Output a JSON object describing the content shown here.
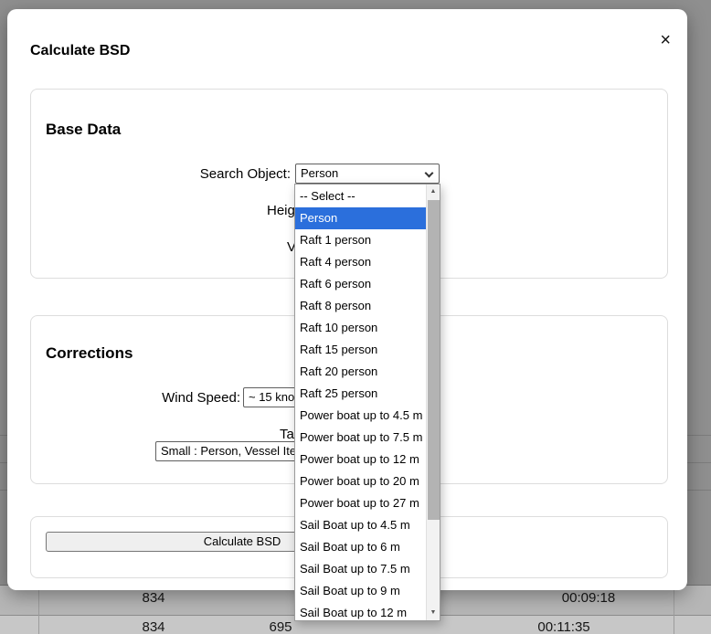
{
  "modal": {
    "title": "Calculate BSD",
    "close_icon": "×",
    "base_data": {
      "section_title": "Base Data",
      "search_object_label": "Search Object:",
      "search_object_value": "Person",
      "height_label_visible": "Heig",
      "visibility_label_visible": "V"
    },
    "corrections": {
      "section_title": "Corrections",
      "wind_speed_label": "Wind Speed:",
      "wind_speed_value": "~ 15 knots",
      "target_label_visible": "Ta",
      "target_type_value": "Small : Person, Vessel Items"
    },
    "actions": {
      "calculate_button_label": "Calculate BSD"
    }
  },
  "search_object_dropdown": {
    "selected": "Person",
    "highlight_color": "#2b6fdc",
    "scroll_up_icon": "▲",
    "scroll_down_icon": "▼",
    "options": [
      "-- Select --",
      "Person",
      "Raft 1 person",
      "Raft 4 person",
      "Raft 6 person",
      "Raft 8 person",
      "Raft 10 person",
      "Raft 15 person",
      "Raft 20 person",
      "Raft 25 person",
      "Power boat up to 4.5 m",
      "Power boat up to 7.5 m",
      "Power boat up to 12 m",
      "Power boat up to 20 m",
      "Power boat up to 27 m",
      "Sail Boat up to 4.5 m",
      "Sail Boat up to 6 m",
      "Sail Boat up to 7.5 m",
      "Sail Boat up to 9 m",
      "Sail Boat up to 12 m"
    ]
  },
  "background_table": {
    "rows": [
      {
        "col1": "834",
        "col2": "",
        "col3": "00:09:18"
      },
      {
        "col1": "834",
        "col2": "695",
        "col3": "00:11:35"
      }
    ]
  }
}
